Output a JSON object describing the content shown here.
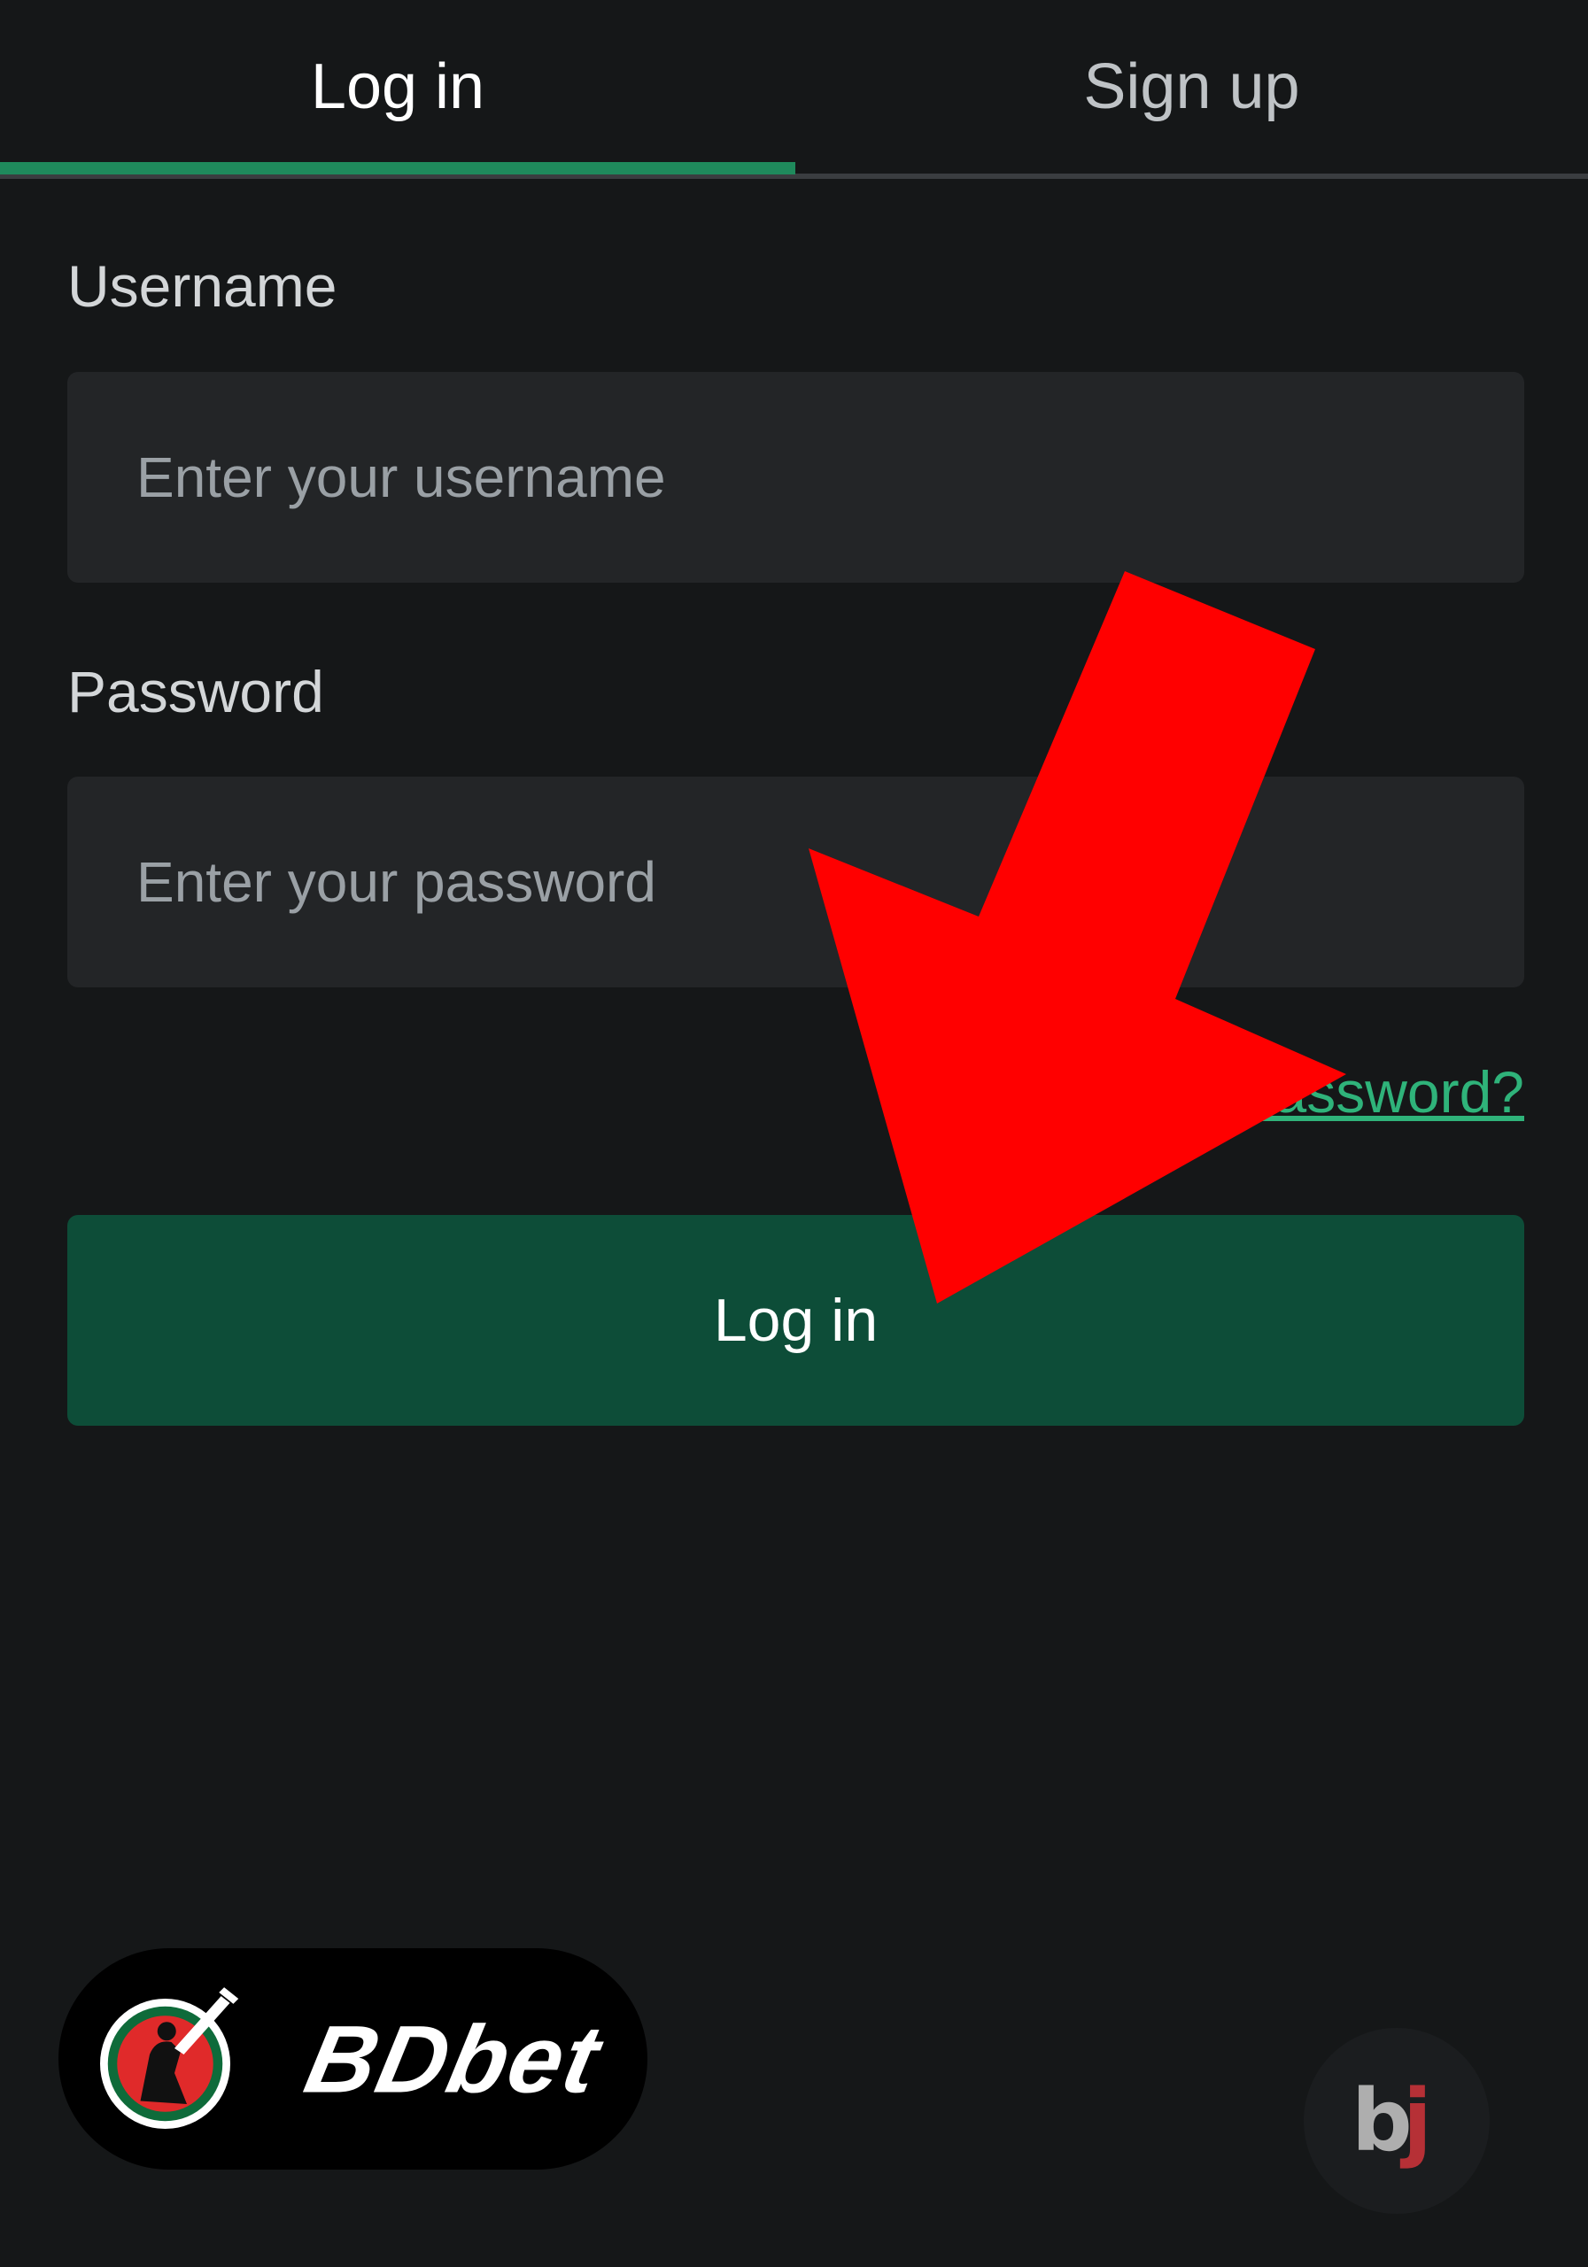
{
  "tabs": {
    "login": "Log in",
    "signup": "Sign up"
  },
  "form": {
    "username_label": "Username",
    "username_placeholder": "Enter your username",
    "password_label": "Password",
    "password_placeholder": "Enter your password",
    "forgot_link": "Forgot password?",
    "submit_label": "Log in"
  },
  "brand": {
    "name": "BDbet",
    "corner_mark": "bj"
  },
  "colors": {
    "background": "#151718",
    "accent": "#1f8a5c",
    "button": "#0d4d38",
    "link": "#2fb37a",
    "arrow": "#ff0000"
  },
  "icons": {
    "overlay": "arrow-down-left-icon",
    "brand_logo": "cricket-batsman-icon"
  }
}
